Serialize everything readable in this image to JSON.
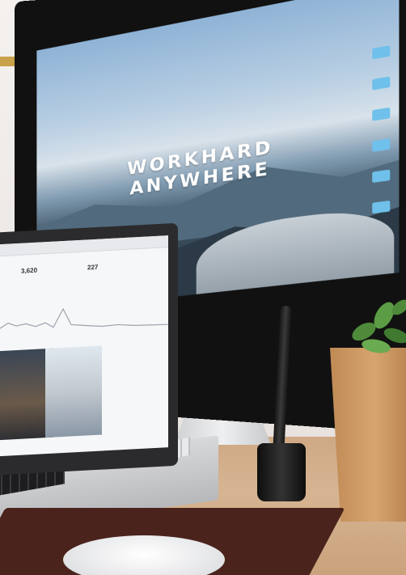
{
  "image": {
    "description_kind": "photo",
    "colors": {
      "wall": "#f1eeec",
      "desk": "#d2ad89",
      "deskpad": "#4a231c",
      "screen_accent": "#6fc0ea"
    }
  },
  "imac_screen": {
    "headline_line1": "WORKHARD",
    "headline_line2": "ANYWHERE",
    "folder_icon_count": 6
  },
  "laptop_screen": {
    "stats": [
      {
        "value": "3,620"
      },
      {
        "value": "227"
      }
    ]
  },
  "icons": [
    "wall-bracket-icon",
    "folder-icon",
    "plant-icon"
  ]
}
